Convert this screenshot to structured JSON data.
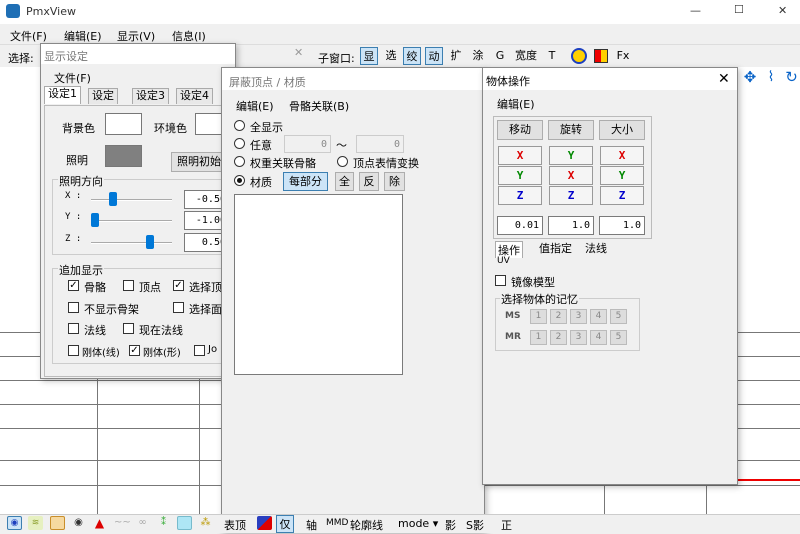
{
  "app": {
    "title": "PmxView",
    "window_controls": [
      "—",
      "☐",
      "✕"
    ]
  },
  "menu": [
    "文件(F)",
    "编辑(E)",
    "显示(V)",
    "信息(I)"
  ],
  "toolbar": {
    "select_label": "选择:",
    "subwindow_label": "子窗口:",
    "items": [
      "显",
      "选",
      "绞",
      "动",
      "扩",
      "涂",
      "G",
      "宽度",
      "T",
      "Fx"
    ]
  },
  "display_settings": {
    "title": "显示设定",
    "menu": "文件(F)",
    "tabs": [
      "设定1",
      "设定",
      "设定3",
      "设定4"
    ],
    "bg_color_label": "背景色",
    "env_color_label": "环境色",
    "light_label": "照明",
    "light_reset_button": "照明初始",
    "light_dir_group": "照明方向",
    "axes": [
      {
        "label": "X :",
        "value": "-0.50",
        "level": 0.15
      },
      {
        "label": "Y :",
        "value": "-1.00",
        "level": 0.0
      },
      {
        "label": "Z :",
        "value": "0.50",
        "level": 0.75
      }
    ],
    "extra_group": "追加显示",
    "checks": [
      {
        "label": "骨骼",
        "checked": true
      },
      {
        "label": "顶点",
        "checked": false
      },
      {
        "label": "选择顶",
        "checked": true
      },
      {
        "label": "不显示骨架",
        "checked": false
      },
      {
        "label": "选择面",
        "checked": false
      },
      {
        "label": "法线",
        "checked": false
      },
      {
        "label": "现在法线",
        "checked": false
      },
      {
        "label": "刚体(线)",
        "checked": false
      },
      {
        "label": "刚体(形)",
        "checked": true
      },
      {
        "label": "Jo",
        "checked": false
      }
    ]
  },
  "mask_window": {
    "title": "屏蔽顶点 / 材质",
    "menu": [
      "编辑(E)",
      "骨骼关联(B)"
    ],
    "all_label": "全显示",
    "any_label": "任意",
    "any_from": "0",
    "tilde": "～",
    "any_to": "0",
    "weight_label": "权重关联骨骼",
    "morph_label": "顶点表情变换",
    "material_label": "材质",
    "each_button": "每部分",
    "all_button": "全",
    "invert_button": "反",
    "remove_button": "除"
  },
  "object_ops": {
    "title": "物体操作",
    "menu": "编辑(E)",
    "columns": [
      "移动",
      "旋转",
      "大小"
    ],
    "grid": [
      [
        "X",
        "Y",
        "X"
      ],
      [
        "Y",
        "X",
        "Y"
      ],
      [
        "Z",
        "Z",
        "Z"
      ]
    ],
    "values": [
      "0.01",
      "1.0",
      "1.0"
    ],
    "tabs": [
      "操作",
      "值指定",
      "法线",
      "UV"
    ],
    "mirror_label": "镜像模型",
    "memory_group": "选择物体的记忆",
    "ms_label": "MS",
    "mr_label": "MR",
    "slots": [
      "1",
      "2",
      "3",
      "4",
      "5"
    ]
  },
  "bottom_bar": {
    "labels": [
      "表顶",
      "仅",
      "轴",
      "MMD",
      "轮廓线",
      "mode ▾",
      "影",
      "S影",
      "正"
    ]
  },
  "colors": {
    "x_axis": "#dd0000",
    "y_axis": "#008800",
    "z_axis": "#0000cc",
    "accent": "#0078d7"
  }
}
